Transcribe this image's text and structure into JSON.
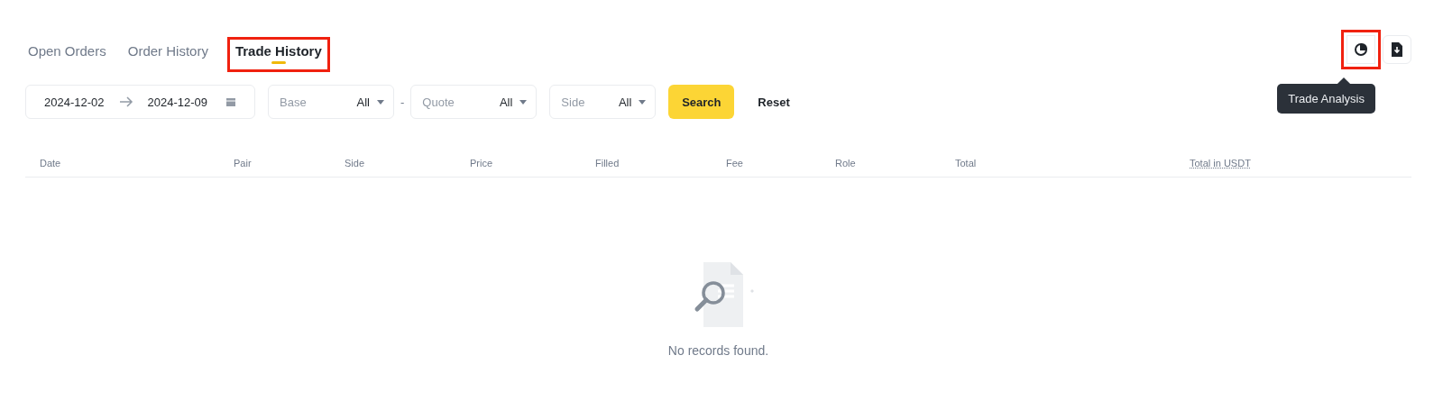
{
  "tabs": [
    {
      "label": "Open Orders",
      "selected": false,
      "highlighted": false
    },
    {
      "label": "Order History",
      "selected": false,
      "highlighted": false
    },
    {
      "label": "Trade History",
      "selected": true,
      "highlighted": true
    }
  ],
  "toolbar": {
    "analysis_button": {
      "highlighted": true
    },
    "tooltip": "Trade Analysis"
  },
  "filters": {
    "date_from": "2024-12-02",
    "date_to": "2024-12-09",
    "selects": [
      {
        "label": "Base",
        "value": "All"
      },
      {
        "label": "Quote",
        "value": "All"
      },
      {
        "label": "Side",
        "value": "All"
      }
    ],
    "separator": "-",
    "search_button": "Search",
    "reset_button": "Reset"
  },
  "table": {
    "columns": [
      {
        "label": "Date",
        "dotted": false
      },
      {
        "label": "Pair",
        "dotted": false
      },
      {
        "label": "Side",
        "dotted": false
      },
      {
        "label": "Price",
        "dotted": false
      },
      {
        "label": "Filled",
        "dotted": false
      },
      {
        "label": "Fee",
        "dotted": false
      },
      {
        "label": "Role",
        "dotted": false
      },
      {
        "label": "Total",
        "dotted": false
      },
      {
        "label": "Total in USDT",
        "dotted": true
      }
    ],
    "empty_text": "No records found."
  }
}
